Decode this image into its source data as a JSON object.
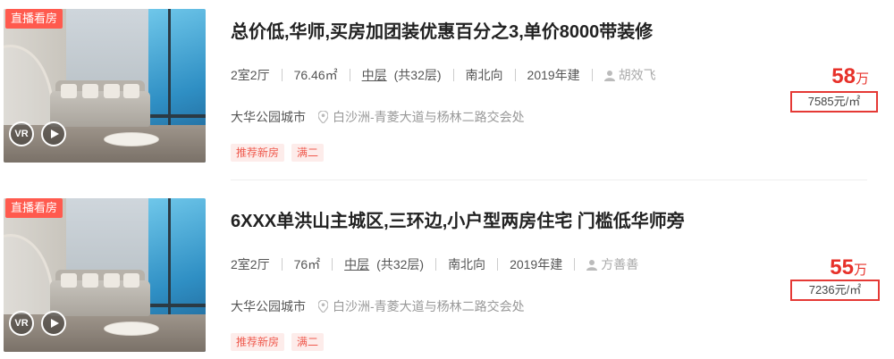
{
  "listings": [
    {
      "badge": "直播看房",
      "vr_label": "VR",
      "title": "总价低,华师,买房加团装优惠百分之3,单价8000带装修",
      "layout": "2室2厅",
      "area": "76.46㎡",
      "floor": "中层",
      "floor_total": "(共32层)",
      "orientation": "南北向",
      "year": "2019年建",
      "agent": "胡效飞",
      "community": "大华公园城市",
      "address": "白沙洲-青菱大道与杨林二路交会处",
      "tags": [
        "推荐新房",
        "满二"
      ],
      "price": "58",
      "price_unit": "万",
      "unit_price": "7585元/㎡"
    },
    {
      "badge": "直播看房",
      "vr_label": "VR",
      "title": "6XXX单洪山主城区,三环边,小户型两房住宅 门槛低华师旁",
      "layout": "2室2厅",
      "area": "76㎡",
      "floor": "中层",
      "floor_total": "(共32层)",
      "orientation": "南北向",
      "year": "2019年建",
      "agent": "方善善",
      "community": "大华公园城市",
      "address": "白沙洲-青菱大道与杨林二路交会处",
      "tags": [
        "推荐新房",
        "满二"
      ],
      "price": "55",
      "price_unit": "万",
      "unit_price": "7236元/㎡"
    }
  ]
}
